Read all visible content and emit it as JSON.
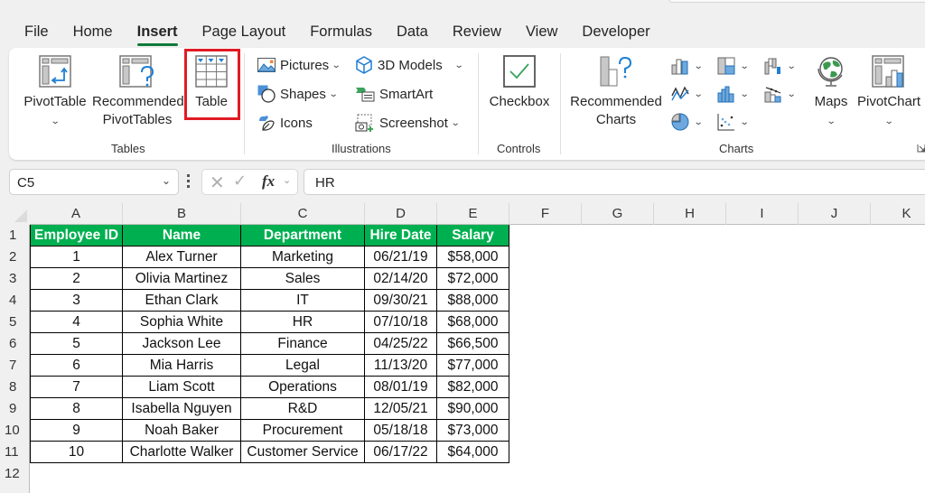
{
  "menu": {
    "tabs": [
      "File",
      "Home",
      "Insert",
      "Page Layout",
      "Formulas",
      "Data",
      "Review",
      "View",
      "Developer"
    ],
    "active": "Insert"
  },
  "ribbon": {
    "tables": {
      "label": "Tables",
      "pivottable": "PivotTable",
      "recommended_pivot_1": "Recommended",
      "recommended_pivot_2": "PivotTables",
      "table": "Table"
    },
    "illustrations": {
      "label": "Illustrations",
      "pictures": "Pictures",
      "shapes": "Shapes",
      "icons": "Icons",
      "models3d": "3D Models",
      "smartart": "SmartArt",
      "screenshot": "Screenshot"
    },
    "controls": {
      "label": "Controls",
      "checkbox": "Checkbox"
    },
    "charts": {
      "label": "Charts",
      "recommended_1": "Recommended",
      "recommended_2": "Charts",
      "maps": "Maps",
      "pivotchart": "PivotChart"
    },
    "highlight_color": "#e01b24"
  },
  "formula_bar": {
    "name_box": "C5",
    "fx_label": "fx",
    "formula": "HR"
  },
  "sheet": {
    "columns": [
      "A",
      "B",
      "C",
      "D",
      "E",
      "F",
      "G",
      "H",
      "I",
      "J",
      "K"
    ],
    "rows": [
      "1",
      "2",
      "3",
      "4",
      "5",
      "6",
      "7",
      "8",
      "9",
      "10",
      "11",
      "12"
    ],
    "header_color": "#00b050",
    "headers": [
      "Employee ID",
      "Name",
      "Department",
      "Hire Date",
      "Salary"
    ],
    "data": [
      [
        "1",
        "Alex Turner",
        "Marketing",
        "06/21/19",
        "$58,000"
      ],
      [
        "2",
        "Olivia Martinez",
        "Sales",
        "02/14/20",
        "$72,000"
      ],
      [
        "3",
        "Ethan Clark",
        "IT",
        "09/30/21",
        "$88,000"
      ],
      [
        "4",
        "Sophia White",
        "HR",
        "07/10/18",
        "$68,000"
      ],
      [
        "5",
        "Jackson Lee",
        "Finance",
        "04/25/22",
        "$66,500"
      ],
      [
        "6",
        "Mia Harris",
        "Legal",
        "11/13/20",
        "$77,000"
      ],
      [
        "7",
        "Liam Scott",
        "Operations",
        "08/01/19",
        "$82,000"
      ],
      [
        "8",
        "Isabella Nguyen",
        "R&D",
        "12/05/21",
        "$90,000"
      ],
      [
        "9",
        "Noah Baker",
        "Procurement",
        "05/18/18",
        "$73,000"
      ],
      [
        "10",
        "Charlotte Walker",
        "Customer Service",
        "06/17/22",
        "$64,000"
      ]
    ]
  }
}
